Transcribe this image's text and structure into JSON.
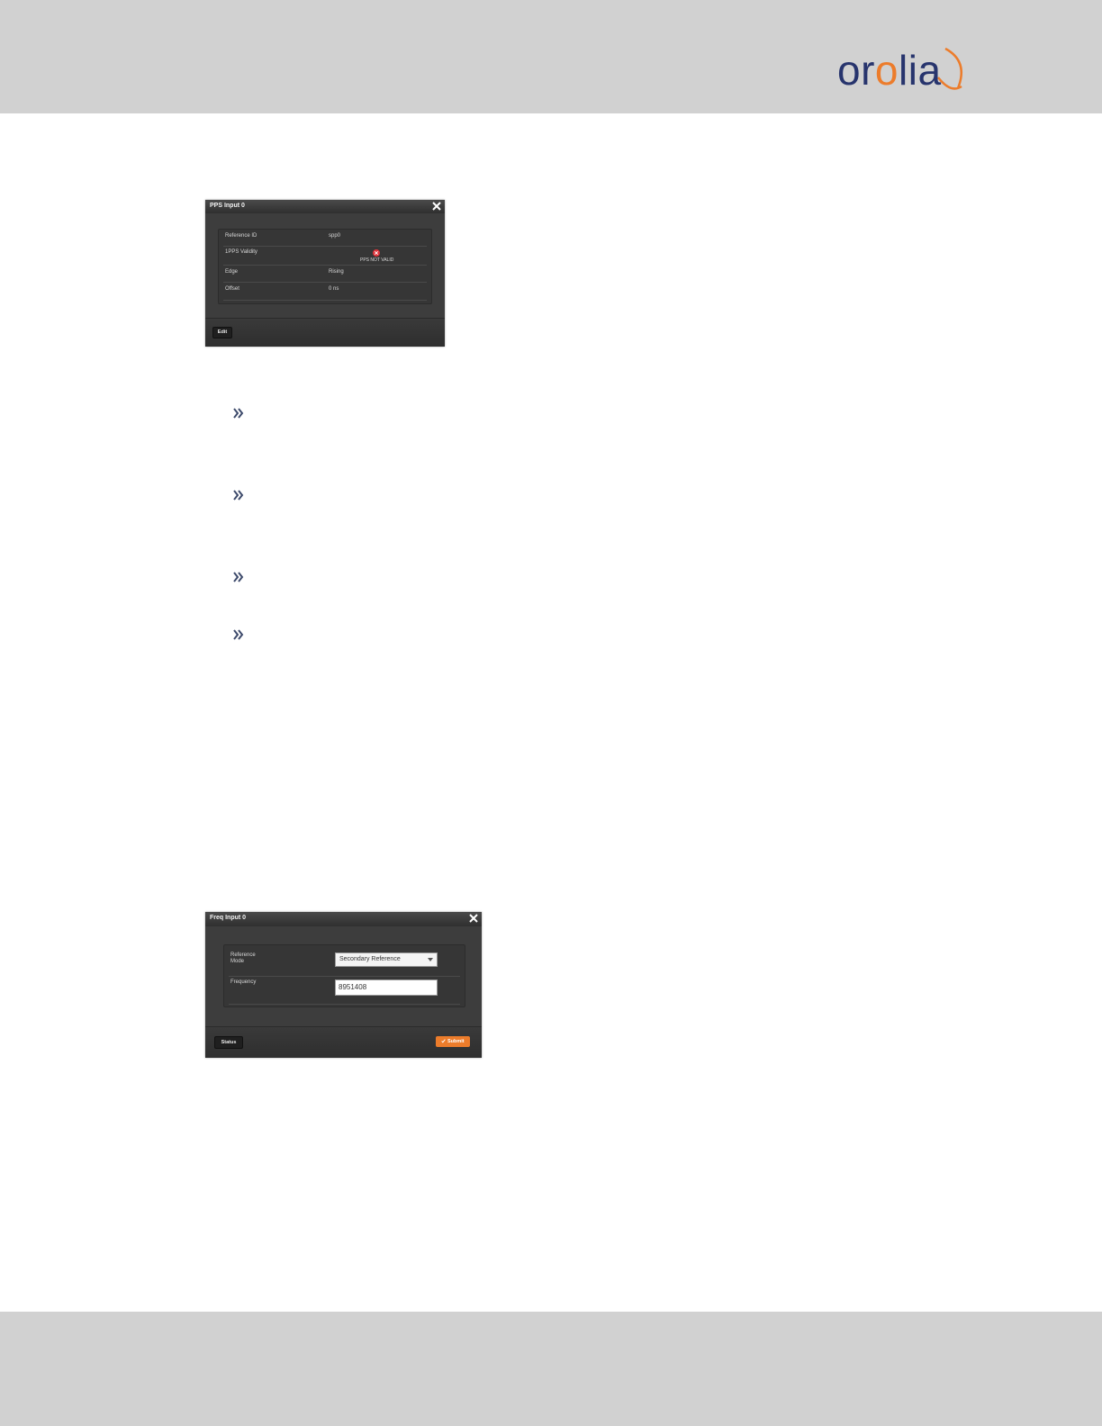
{
  "brand": {
    "logo_text_a": "or",
    "logo_text_b": "o",
    "logo_text_c": "lia",
    "color_primary": "#27346d",
    "color_accent": "#ec7c2b"
  },
  "pps_dialog": {
    "title": "PPS Input 0",
    "rows": [
      {
        "label": "Reference ID",
        "value": "spp0"
      },
      {
        "label": "1PPS Validity",
        "value": "PPS NOT VALID"
      },
      {
        "label": "Edge",
        "value": "Rising"
      },
      {
        "label": "Offset",
        "value": "0 ns"
      }
    ],
    "edit_label": "Edit"
  },
  "freq_dialog": {
    "title": "Freq Input 0",
    "mode_label_line1": "Reference",
    "mode_label_line2": "Mode",
    "mode_selected": "Secondary Reference",
    "frequency_label": "Frequency",
    "frequency_value": "8951408",
    "status_label": "Status",
    "submit_label": "Submit"
  },
  "icons": {
    "close": "close-icon",
    "alert": "alert-icon",
    "dropdown": "chevron-down-icon",
    "check": "check-icon",
    "bullet": "double-chevron-right-icon"
  }
}
